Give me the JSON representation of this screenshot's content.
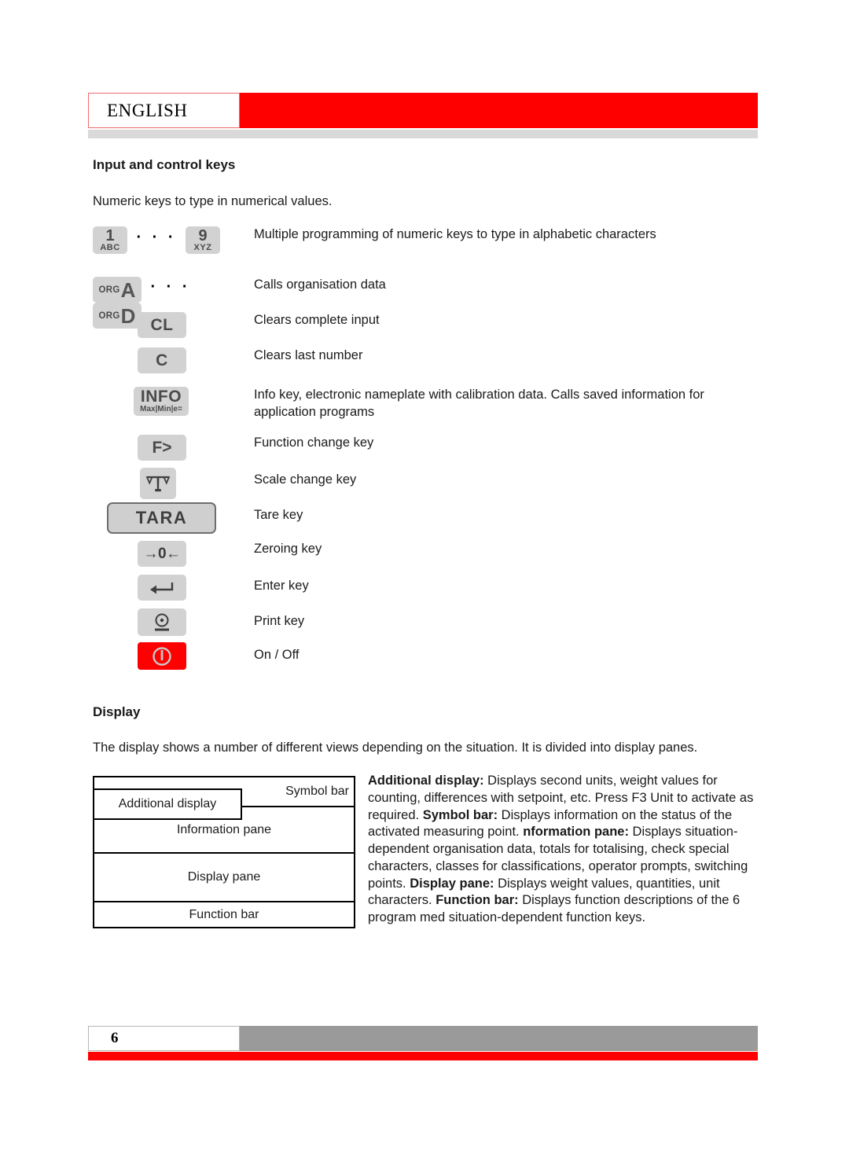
{
  "header": {
    "language_tab": "ENGLISH"
  },
  "sections": {
    "keys_title": "Input and control keys",
    "keys_intro": "Numeric keys to type in numerical values.",
    "display_title": "Display",
    "display_intro": "The display shows a number of different views depending on the situation. It is divided into display panes."
  },
  "keys": [
    {
      "type": "numeric-range",
      "icon_name": "numeric-keys-1-to-9",
      "cap_from_big": "1",
      "cap_from_small": "ABC",
      "cap_to_big": "9",
      "cap_to_small": "XYZ",
      "ellipsis": "· · ·",
      "description": "Multiple programming of numeric keys to type in alphabetic characters"
    },
    {
      "type": "org-range",
      "icon_name": "org-keys-a-to-d",
      "org_label": "ORG",
      "cap_from_letter": "A",
      "cap_to_letter": "D",
      "ellipsis": "· · ·",
      "description": "Calls organisation data"
    },
    {
      "type": "text",
      "icon_name": "clear-all-key",
      "cap_label": "CL",
      "description": "Clears complete input"
    },
    {
      "type": "text",
      "icon_name": "clear-last-key",
      "cap_label": "C",
      "description": "Clears last number"
    },
    {
      "type": "info",
      "icon_name": "info-key",
      "cap_label": "INFO",
      "cap_sub": "Max|Min|e=",
      "description": "Info key, electronic nameplate with calibration data. Calls saved information for application programs"
    },
    {
      "type": "text",
      "icon_name": "function-change-key",
      "cap_label": "F>",
      "description": "Function change key"
    },
    {
      "type": "scale",
      "icon_name": "scale-change-key",
      "description": "Scale change key"
    },
    {
      "type": "tara",
      "icon_name": "tare-key",
      "cap_label": "TARA",
      "description": "Tare key"
    },
    {
      "type": "zero",
      "icon_name": "zeroing-key",
      "cap_label": "→0←",
      "description": "Zeroing key"
    },
    {
      "type": "enter",
      "icon_name": "enter-key",
      "description": "Enter key"
    },
    {
      "type": "print",
      "icon_name": "print-key",
      "description": "Print key"
    },
    {
      "type": "power",
      "icon_name": "on-off-key",
      "description": "On / Off"
    }
  ],
  "diagram": {
    "additional_display": "Additional display",
    "symbol_bar": "Symbol bar",
    "information_pane": "Information pane",
    "display_pane": "Display pane",
    "function_bar": "Function bar"
  },
  "descriptions": [
    {
      "term": "Additional display:",
      "text": " Displays second units, weight values for counting, differences with setpoint, etc. Press F3 Unit to activate as required."
    },
    {
      "term": "Symbol bar:",
      "text": " Displays information on the status of the activated measuring point."
    },
    {
      "term": "nformation pane:",
      "text": " Displays situation-dependent organisation data, totals for totalising, check special characters, classes for classifications, operator prompts, switching points."
    },
    {
      "term": "Display pane:",
      "text": "  Displays weight values, quantities, unit characters."
    },
    {
      "term": "Function bar:",
      "text": " Displays function descriptions of the 6 program med situation-dependent function keys."
    }
  ],
  "footer": {
    "page_number": "6"
  },
  "colors": {
    "brand_red": "#fe0000",
    "header_gray": "#d9d9d9",
    "footer_gray": "#9a9a9a",
    "key_gray": "#d2d2d2"
  }
}
